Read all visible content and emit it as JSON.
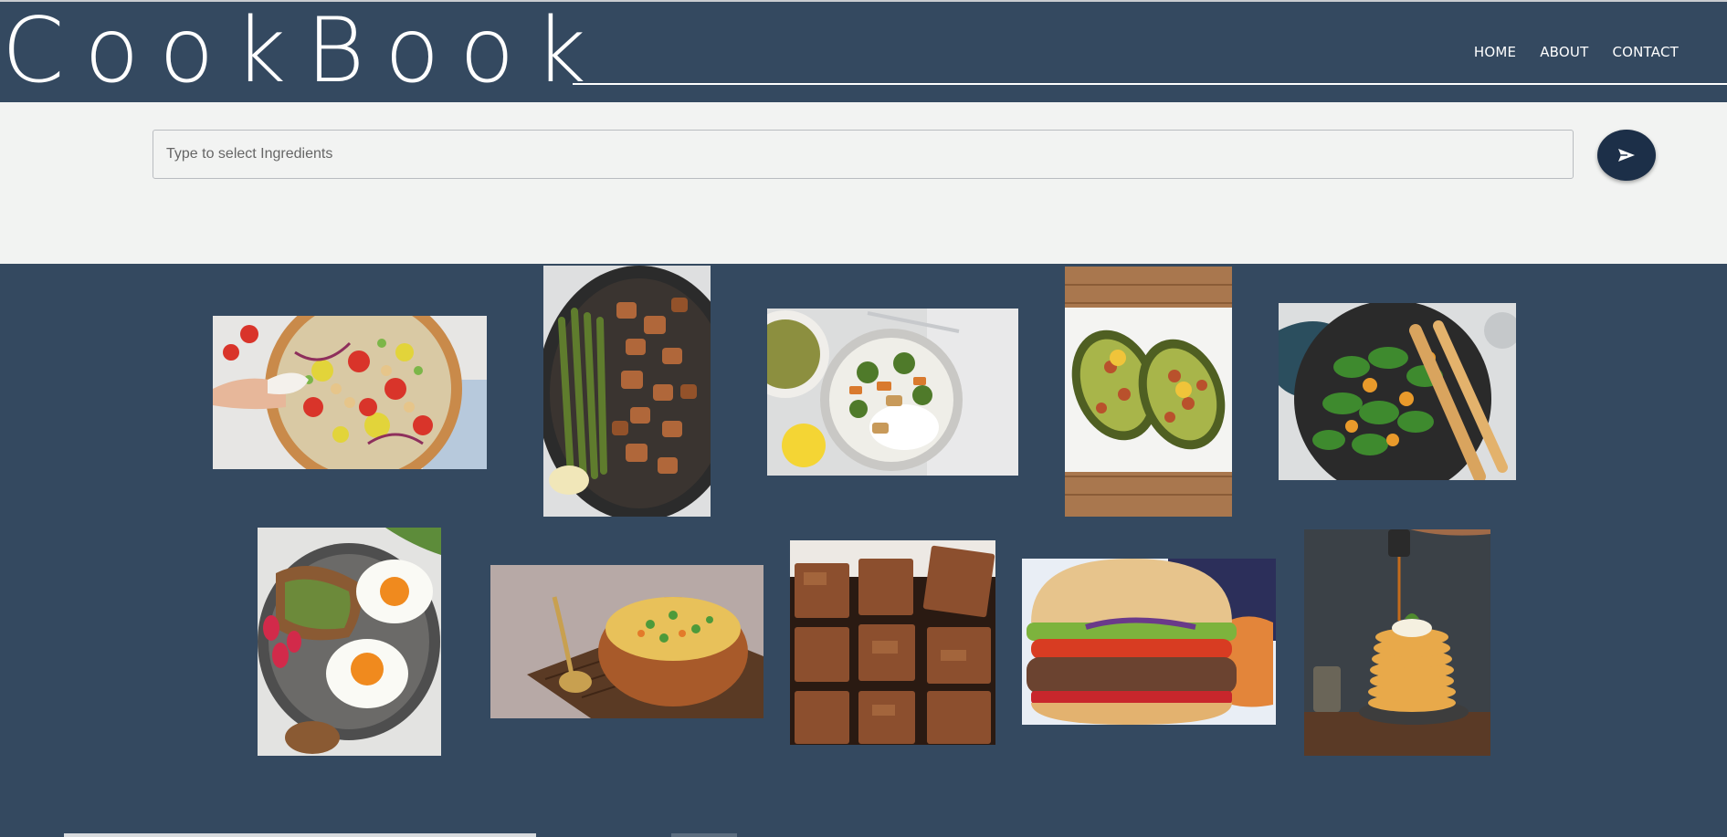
{
  "header": {
    "logo": "CookBook",
    "nav": [
      {
        "label": "HOME"
      },
      {
        "label": "ABOUT"
      },
      {
        "label": "CONTACT"
      }
    ]
  },
  "search": {
    "placeholder": "Type to select Ingredients",
    "value": "",
    "send_icon": "send-icon"
  },
  "gallery": {
    "items": [
      {
        "dish": "chickpea-salad"
      },
      {
        "dish": "chicken-asparagus-skillet"
      },
      {
        "dish": "chicken-veggie-rice-bowl"
      },
      {
        "dish": "baked-stuffed-avocado"
      },
      {
        "dish": "spinach-orange-salad"
      },
      {
        "dish": "eggs-on-toast"
      },
      {
        "dish": "pea-curry-bowl"
      },
      {
        "dish": "brownies"
      },
      {
        "dish": "burger-with-chips"
      },
      {
        "dish": "pancake-stack-syrup"
      }
    ]
  },
  "colors": {
    "navy": "#344960",
    "light_band": "#f2f3f2",
    "send_button": "#1c2f48"
  }
}
